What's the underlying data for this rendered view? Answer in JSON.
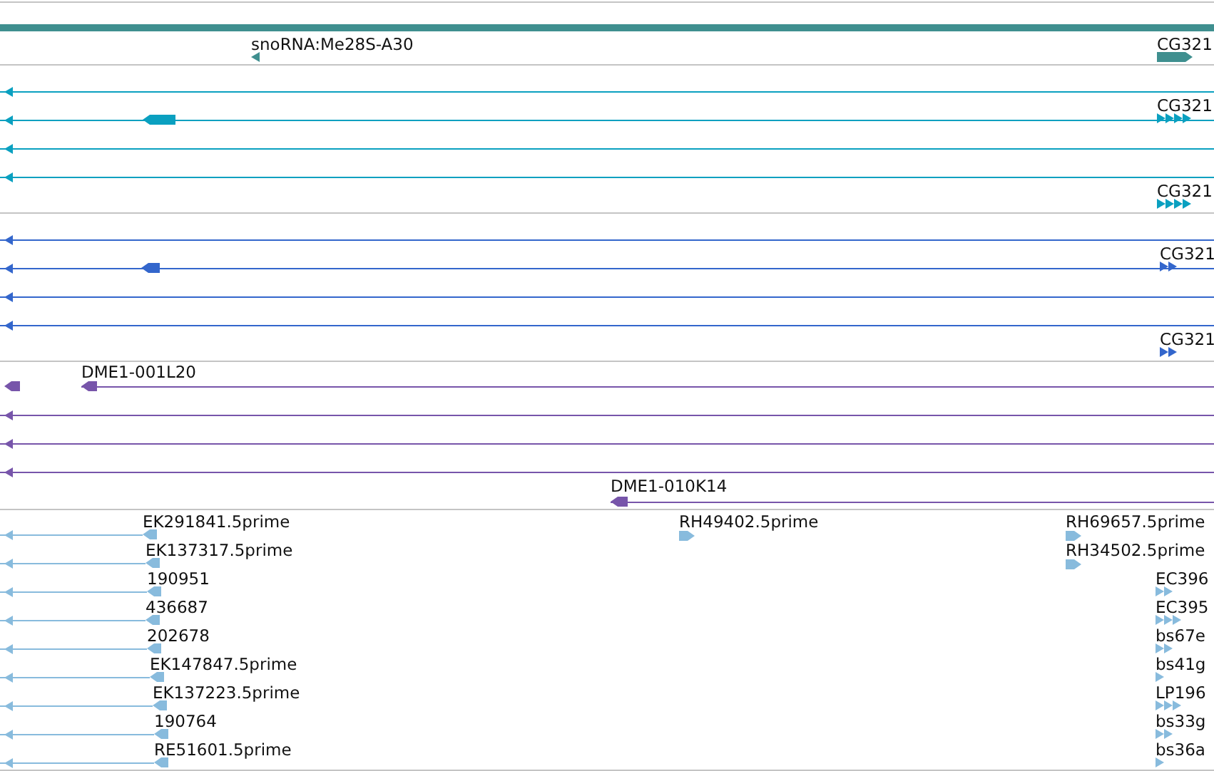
{
  "tracks": [
    {
      "color": "#3f8f8f",
      "features": [
        {
          "label": "snoRNA:Me28S-A30",
          "reverse": true
        },
        {
          "label": "CG321",
          "reverse": false
        }
      ]
    },
    {
      "color": "#0aa0c0",
      "features": [
        {
          "reverse": true
        },
        {
          "reverse": true
        },
        {
          "reverse": true
        },
        {
          "reverse": true
        },
        {
          "label": "CG321",
          "reverse": false
        },
        {
          "label": "CG321",
          "reverse": false
        }
      ]
    },
    {
      "color": "#3366cc",
      "features": [
        {
          "reverse": true
        },
        {
          "reverse": true
        },
        {
          "reverse": true
        },
        {
          "reverse": true
        },
        {
          "label": "CG321",
          "reverse": false
        },
        {
          "label": "CG321",
          "reverse": false
        }
      ]
    },
    {
      "color": "#7755aa",
      "features": [
        {
          "reverse": true
        },
        {
          "label": "DME1-001L20",
          "reverse": true
        },
        {
          "reverse": true
        },
        {
          "reverse": true
        },
        {
          "reverse": true
        },
        {
          "label": "DME1-010K14",
          "reverse": true
        }
      ]
    },
    {
      "color": "#88bbdd",
      "features": [
        {
          "label": "EK291841.5prime",
          "reverse": true
        },
        {
          "label": "EK137317.5prime",
          "reverse": true
        },
        {
          "label": "190951",
          "reverse": true
        },
        {
          "label": "436687",
          "reverse": true
        },
        {
          "label": "202678",
          "reverse": true
        },
        {
          "label": "EK147847.5prime",
          "reverse": true
        },
        {
          "label": "EK137223.5prime",
          "reverse": true
        },
        {
          "label": "190764",
          "reverse": true
        },
        {
          "label": "RE51601.5prime",
          "reverse": true
        },
        {
          "label": "RH49402.5prime",
          "reverse": false
        },
        {
          "label": "RH69657.5prime",
          "reverse": false
        },
        {
          "label": "RH34502.5prime",
          "reverse": false
        },
        {
          "label": "EC396",
          "reverse": false
        },
        {
          "label": "EC395",
          "reverse": false
        },
        {
          "label": "bs67e",
          "reverse": false
        },
        {
          "label": "bs41g",
          "reverse": false
        },
        {
          "label": "LP196",
          "reverse": false
        },
        {
          "label": "bs33g",
          "reverse": false
        },
        {
          "label": "bs36a",
          "reverse": false
        }
      ]
    }
  ]
}
